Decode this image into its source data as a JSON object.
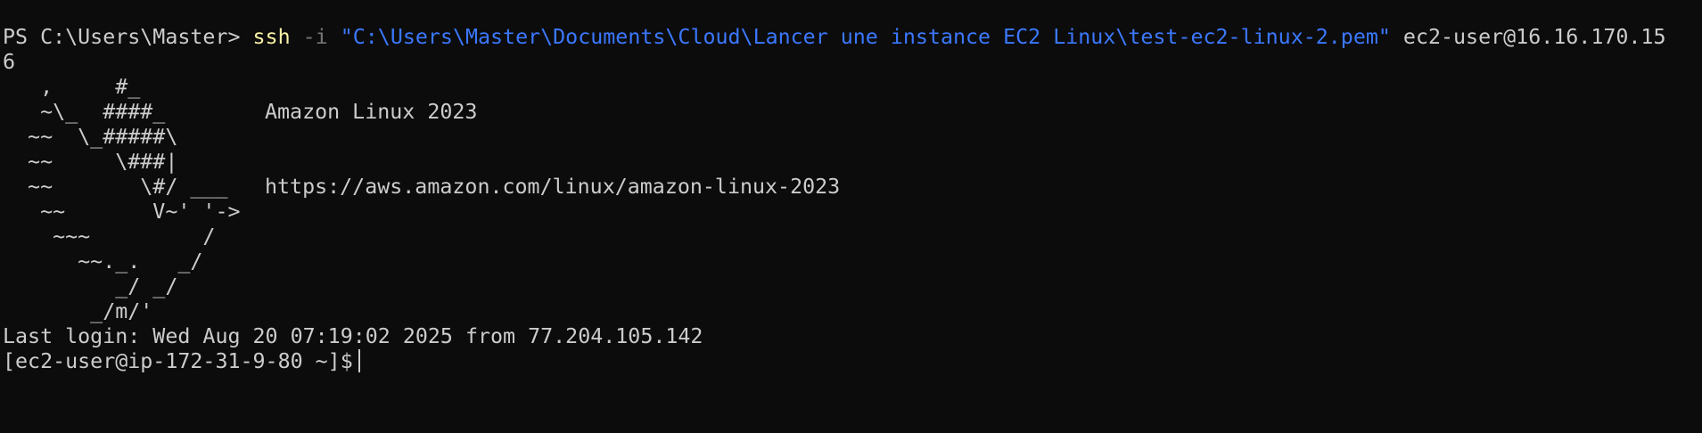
{
  "terminal": {
    "command_line": {
      "prompt": "PS C:\\Users\\Master> ",
      "command": "ssh",
      "flag": " -i ",
      "key_path": "\"C:\\Users\\Master\\Documents\\Cloud\\Lancer une instance EC2 Linux\\test-ec2-linux-2.pem\"",
      "host_part1": " ec2-user@16.16.170.15",
      "host_part2": "6"
    },
    "banner": {
      "art": [
        "   ,     #_",
        "   ~\\_  ####_",
        "  ~~  \\_#####\\",
        "  ~~     \\###|",
        "  ~~       \\#/ ___",
        "   ~~       V~' '->",
        "    ~~~         /",
        "      ~~._.   _/",
        "         _/ _/",
        "       _/m/'"
      ],
      "product_name": "Amazon Linux 2023",
      "product_url": "https://aws.amazon.com/linux/amazon-linux-2023"
    },
    "last_login": "Last login: Wed Aug 20 07:19:02 2025 from 77.204.105.142",
    "shell_prompt": "[ec2-user@ip-172-31-9-80 ~]$"
  },
  "colors": {
    "background": "#0c0c0c",
    "foreground": "#cccccc",
    "command": "#f9f1a5",
    "flag": "#767676",
    "string": "#3b78ff"
  }
}
